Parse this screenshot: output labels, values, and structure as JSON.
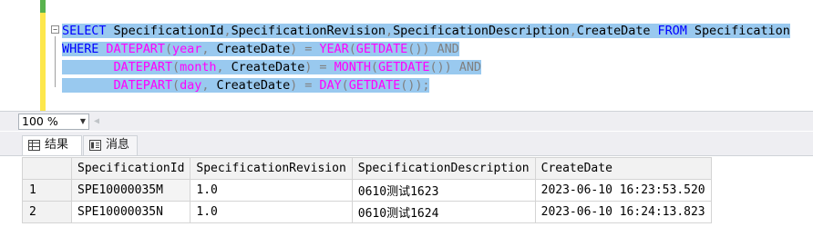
{
  "editor": {
    "collapse_glyph": "−",
    "lines": [
      [
        {
          "t": "SELECT",
          "c": "kw"
        },
        {
          "t": " SpecificationId",
          "c": "tx"
        },
        {
          "t": ",",
          "c": "op"
        },
        {
          "t": "SpecificationRevision",
          "c": "tx"
        },
        {
          "t": ",",
          "c": "op"
        },
        {
          "t": "SpecificationDescription",
          "c": "tx"
        },
        {
          "t": ",",
          "c": "op"
        },
        {
          "t": "CreateDate ",
          "c": "tx"
        },
        {
          "t": "FROM",
          "c": "kw"
        },
        {
          "t": " Specification",
          "c": "tx"
        }
      ],
      [
        {
          "t": "WHERE ",
          "c": "kw"
        },
        {
          "t": "DATEPART",
          "c": "fn"
        },
        {
          "t": "(",
          "c": "op"
        },
        {
          "t": "year",
          "c": "fn"
        },
        {
          "t": ",",
          "c": "op"
        },
        {
          "t": " CreateDate",
          "c": "tx"
        },
        {
          "t": ")",
          "c": "op"
        },
        {
          "t": " = ",
          "c": "op"
        },
        {
          "t": "YEAR",
          "c": "fn"
        },
        {
          "t": "(",
          "c": "op"
        },
        {
          "t": "GETDATE",
          "c": "fn"
        },
        {
          "t": "()) ",
          "c": "op"
        },
        {
          "t": "AND",
          "c": "op"
        }
      ],
      [
        {
          "t": "       ",
          "c": "tx"
        },
        {
          "t": "DATEPART",
          "c": "fn"
        },
        {
          "t": "(",
          "c": "op"
        },
        {
          "t": "month",
          "c": "fn"
        },
        {
          "t": ",",
          "c": "op"
        },
        {
          "t": " CreateDate",
          "c": "tx"
        },
        {
          "t": ")",
          "c": "op"
        },
        {
          "t": " = ",
          "c": "op"
        },
        {
          "t": "MONTH",
          "c": "fn"
        },
        {
          "t": "(",
          "c": "op"
        },
        {
          "t": "GETDATE",
          "c": "fn"
        },
        {
          "t": "()) ",
          "c": "op"
        },
        {
          "t": "AND",
          "c": "op"
        }
      ],
      [
        {
          "t": "       ",
          "c": "tx"
        },
        {
          "t": "DATEPART",
          "c": "fn"
        },
        {
          "t": "(",
          "c": "op"
        },
        {
          "t": "day",
          "c": "fn"
        },
        {
          "t": ",",
          "c": "op"
        },
        {
          "t": " CreateDate",
          "c": "tx"
        },
        {
          "t": ")",
          "c": "op"
        },
        {
          "t": " = ",
          "c": "op"
        },
        {
          "t": "DAY",
          "c": "fn"
        },
        {
          "t": "(",
          "c": "op"
        },
        {
          "t": "GETDATE",
          "c": "fn"
        },
        {
          "t": "());",
          "c": "op"
        }
      ]
    ]
  },
  "zoom": {
    "value": "100 %",
    "arrow_icon": "dropdown-arrow-icon",
    "scroll_icon": "scroll-left-icon"
  },
  "tabs": {
    "results_label": "结果",
    "messages_label": "消息"
  },
  "grid": {
    "columns": [
      "SpecificationId",
      "SpecificationRevision",
      "SpecificationDescription",
      "CreateDate"
    ],
    "rows": [
      {
        "num": "1",
        "cells": [
          "SPE10000035M",
          "1.0",
          "0610测试1623",
          "2023-06-10 16:23:53.520"
        ]
      },
      {
        "num": "2",
        "cells": [
          "SPE10000035N",
          "1.0",
          "0610测试1624",
          "2023-06-10 16:24:13.823"
        ]
      }
    ]
  },
  "colors": {
    "selection": "#99c9ef",
    "keyword": "#0000ff",
    "function": "#ff00ff",
    "operator": "#808080"
  }
}
